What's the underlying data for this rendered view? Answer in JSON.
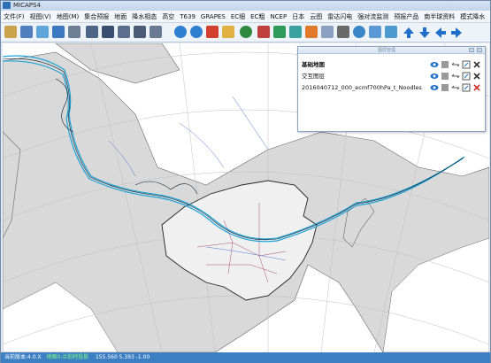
{
  "app": {
    "title": "MICAPS4"
  },
  "menu": [
    "文件(F)",
    "视图(V)",
    "地图(M)",
    "集合预报",
    "地面",
    "降水相态",
    "高空",
    "T639",
    "GRAPES",
    "EC细",
    "EC粗",
    "NCEP",
    "日本",
    "云图",
    "雷达闪电",
    "强对流监测",
    "预报产品",
    "南半球资料",
    "模式降水"
  ],
  "toolbar_icons": [
    "open-icon",
    "save-icon",
    "layers-icon",
    "home-icon",
    "grid-icon",
    "window-icon",
    "picture-icon",
    "map-icon",
    "chart-icon",
    "export-icon",
    "undo-icon",
    "redo-icon",
    "flag-icon",
    "folder-icon",
    "globe-icon",
    "color-icon",
    "stack-icon",
    "cube-icon",
    "palette-icon",
    "document-icon",
    "camera-icon",
    "earth-icon",
    "adjust-icon",
    "calendar-icon",
    "up-arrow-icon",
    "down-arrow-icon",
    "left-arrow-icon",
    "right-arrow-icon"
  ],
  "layer_panel": {
    "header": "图层管理",
    "layers": [
      {
        "name": "基础地图",
        "bold": true
      },
      {
        "name": "交互图层",
        "bold": false
      },
      {
        "name": "2016040712_000_ecmf700hPa_t_Noodles",
        "bold": false
      }
    ]
  },
  "status": {
    "version": "当前版本:4.0.X",
    "projection": "地图0-兰伯特投影",
    "coords": "155.560  5.393  -1.00"
  },
  "colors": {
    "accent": "#3c7fc3",
    "ocean": "#ffffff",
    "land": "#d9d9d9",
    "noodle": "#1fa3d8"
  }
}
